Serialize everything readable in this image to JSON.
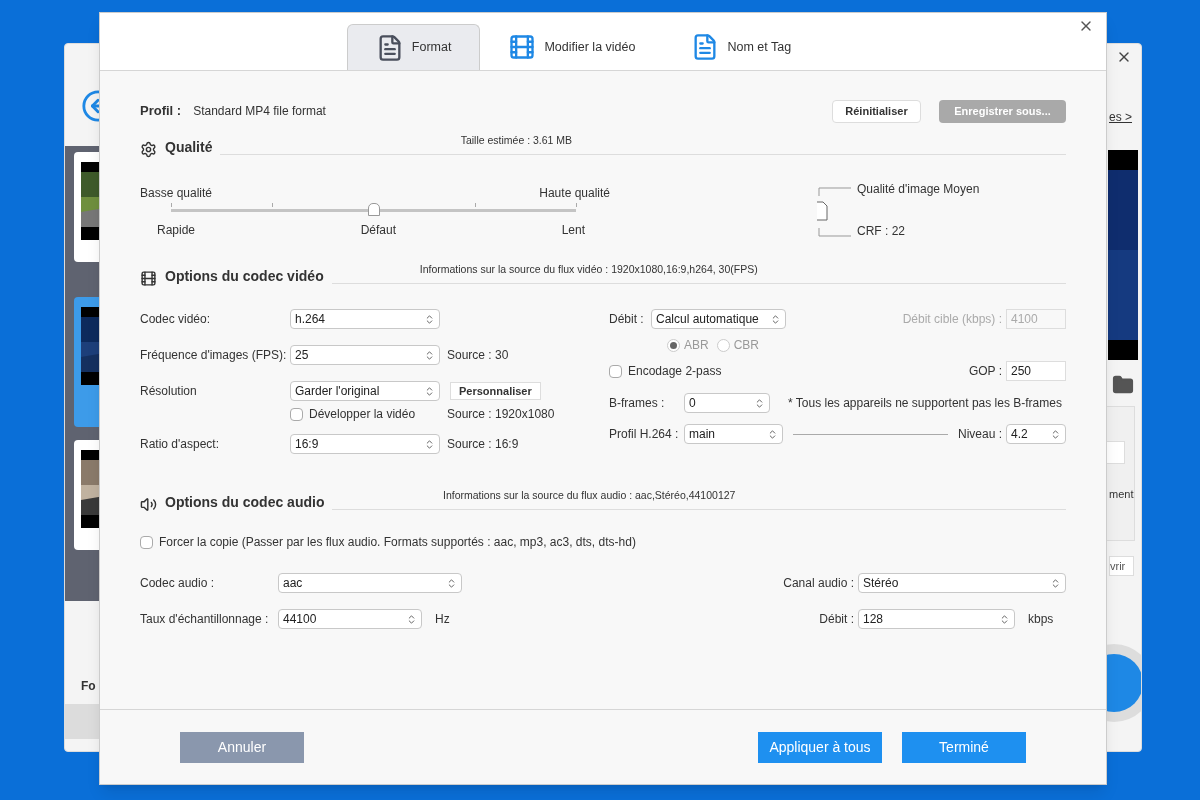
{
  "background_window": {
    "link_fragment": "es >",
    "label_fragment": "Fo",
    "text_fragment": "ment",
    "button_fragment": "vrir",
    "thumbnails": [
      {
        "selected": false
      },
      {
        "selected": true
      },
      {
        "selected": false
      }
    ]
  },
  "dialog": {
    "tabs": [
      {
        "label": "Format",
        "selected": true
      },
      {
        "label": "Modifier la vidéo",
        "selected": false
      },
      {
        "label": "Nom et Tag",
        "selected": false
      }
    ],
    "profile": {
      "label": "Profil :",
      "value": "Standard MP4 file format"
    },
    "profile_buttons": [
      {
        "label": "Réinitialiser",
        "disabled": false
      },
      {
        "label": "Enregistrer sous...",
        "disabled": true
      }
    ],
    "quality": {
      "title": "Qualité",
      "estimated_size": "Taille estimée : 3.61 MB",
      "low_label": "Basse qualité",
      "high_label": "Haute qualité",
      "level": 0.5,
      "speed_labels": [
        "Rapide",
        "Défaut",
        "Lent"
      ],
      "image_quality": "Qualité d'image Moyen",
      "crf": "CRF : 22"
    },
    "video": {
      "title": "Options du codec vidéo",
      "source_info": "Informations sur la source du flux vidéo : 1920x1080,16:9,h264, 30(FPS)",
      "codec": {
        "label": "Codec vidéo:",
        "value": "h.264"
      },
      "fps": {
        "label": "Fréquence d'images (FPS):",
        "value": "25",
        "source": "Source : 30"
      },
      "resolution": {
        "label": "Résolution",
        "value": "Garder l'original",
        "custom_button": "Personnaliser",
        "source": "Source : 1920x1080"
      },
      "expand": {
        "label": "Développer la vidéo",
        "checked": false
      },
      "aspect": {
        "label": "Ratio d'aspect:",
        "value": "16:9",
        "source": "Source : 16:9"
      },
      "bitrate": {
        "label": "Débit :",
        "value": "Calcul automatique"
      },
      "target": {
        "label": "Débit cible (kbps) :",
        "value": "4100",
        "disabled": true
      },
      "modes": [
        {
          "label": "ABR",
          "selected": true
        },
        {
          "label": "CBR",
          "selected": false
        }
      ],
      "two_pass": {
        "label": "Encodage 2-pass",
        "checked": false
      },
      "gop": {
        "label": "GOP :",
        "value": "250"
      },
      "bframes": {
        "label": "B-frames :",
        "value": "0",
        "note": "* Tous les appareils ne supportent pas les B-frames"
      },
      "h264_profile": {
        "label": "Profil H.264 :",
        "value": "main"
      },
      "level_select": {
        "label": "Niveau :",
        "value": "4.2"
      }
    },
    "audio": {
      "title": "Options du codec audio",
      "source_info": "Informations sur la source du flux audio : aac,Stéréo,44100127",
      "force_copy": {
        "label": "Forcer la copie (Passer par les flux audio. Formats supportés : aac, mp3, ac3, dts, dts-hd)",
        "checked": false
      },
      "codec": {
        "label": "Codec audio :",
        "value": "aac"
      },
      "channel": {
        "label": "Canal audio :",
        "value": "Stéréo"
      },
      "sample_rate": {
        "label": "Taux d'échantillonnage :",
        "value": "44100",
        "unit": "Hz"
      },
      "bitrate": {
        "label": "Débit :",
        "value": "128",
        "unit": "kbps"
      }
    },
    "footer_buttons": [
      {
        "label": "Annuler",
        "kind": "secondary"
      },
      {
        "label": "Appliquer à tous",
        "kind": "primary"
      },
      {
        "label": "Terminé",
        "kind": "primary"
      }
    ]
  }
}
